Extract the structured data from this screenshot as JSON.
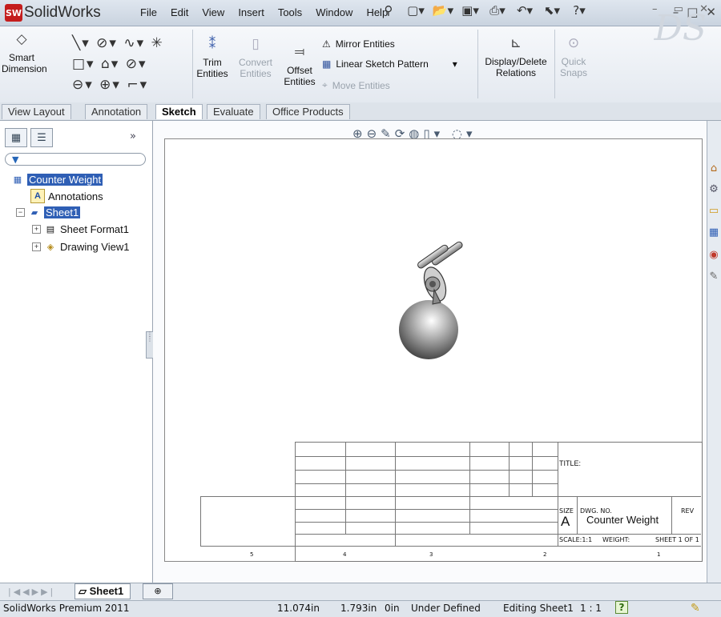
{
  "app": {
    "logo_badge": "SW",
    "title": "SolidWorks",
    "brand_color": "#c41d1d"
  },
  "menus": [
    "File",
    "Edit",
    "View",
    "Insert",
    "Tools",
    "Window",
    "Help"
  ],
  "ribbon": {
    "smart_dimension": "Smart Dimension",
    "trim_entities": "Trim Entities",
    "convert_entities": "Convert Entities",
    "offset_entities": "Offset Entities",
    "mirror_entities": "Mirror Entities",
    "linear_sketch_pattern": "Linear Sketch Pattern",
    "move_entities": "Move Entities",
    "display_delete_relations": "Display/Delete Relations",
    "quick_snaps": "Quick Snaps"
  },
  "tabs": [
    "View Layout",
    "Annotation",
    "Sketch",
    "Evaluate",
    "Office Products"
  ],
  "active_tab": "Sketch",
  "tree": {
    "root": "Counter Weight",
    "annotations": "Annotations",
    "sheet": "Sheet1",
    "sheet_format": "Sheet Format1",
    "drawing_view": "Drawing View1"
  },
  "title_block": {
    "title_label": "TITLE:",
    "size_label": "SIZE",
    "size_value": "A",
    "dwg_no_label": "DWG. NO.",
    "dwg_no_value": "Counter Weight",
    "rev_label": "REV",
    "scale_label": "SCALE:1:1",
    "weight_label": "WEIGHT:",
    "sheet_label": "SHEET 1 OF 1",
    "zones": [
      "5",
      "4",
      "3",
      "2",
      "1"
    ]
  },
  "sheet_tab": "Sheet1",
  "status": {
    "product": "SolidWorks Premium 2011",
    "x": "11.074in",
    "y": "1.793in",
    "z": "0in",
    "state": "Under Defined",
    "editing": "Editing Sheet1",
    "scale": "1 : 1",
    "help": "?"
  }
}
